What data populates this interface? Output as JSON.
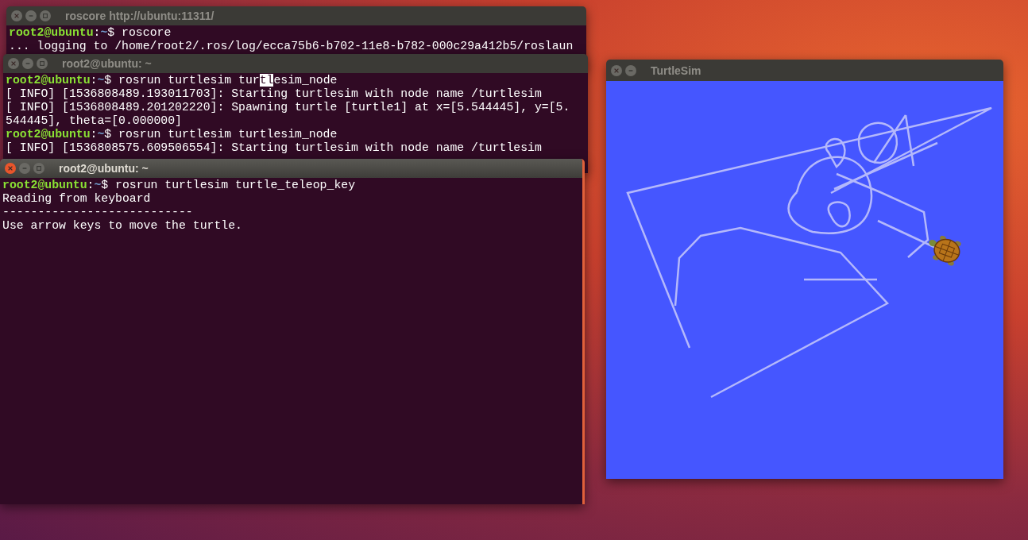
{
  "windows": [
    {
      "kind": "terminal",
      "title": "roscore http://ubuntu:11311/",
      "active": false,
      "lines": [
        {
          "kind": "prompt",
          "user": "root2@ubuntu",
          "separator": ":",
          "path": "~",
          "symbol": "$",
          "segments": [
            {
              "text": " roscore",
              "highlighted": false
            }
          ]
        },
        {
          "kind": "output",
          "text": "... logging to /home/root2/.ros/log/ecca75b6-b702-11e8-b782-000c29a412b5/roslaun"
        }
      ]
    },
    {
      "kind": "terminal",
      "title": "root2@ubuntu: ~",
      "active": false,
      "lines": [
        {
          "kind": "prompt",
          "user": "root2@ubuntu",
          "separator": ":",
          "path": "~",
          "symbol": "$",
          "segments": [
            {
              "text": " rosrun turtlesim tur",
              "highlighted": false
            },
            {
              "text": "tl",
              "highlighted": true
            },
            {
              "text": "esim_node",
              "highlighted": false
            }
          ]
        },
        {
          "kind": "output",
          "text": "[ INFO] [1536808489.193011703]: Starting turtlesim with node name /turtlesim"
        },
        {
          "kind": "output",
          "text": "[ INFO] [1536808489.201202220]: Spawning turtle [turtle1] at x=[5.544445], y=[5."
        },
        {
          "kind": "output",
          "text": "544445], theta=[0.000000]"
        },
        {
          "kind": "prompt",
          "user": "root2@ubuntu",
          "separator": ":",
          "path": "~",
          "symbol": "$",
          "segments": [
            {
              "text": " rosrun turtlesim turtlesim_node",
              "highlighted": false
            }
          ]
        },
        {
          "kind": "output",
          "text": "[ INFO] [1536808575.609506554]: Starting turtlesim with node name /turtlesim"
        }
      ]
    },
    {
      "kind": "terminal",
      "title": "root2@ubuntu: ~",
      "active": true,
      "lines": [
        {
          "kind": "prompt",
          "user": "root2@ubuntu",
          "separator": ":",
          "path": "~",
          "symbol": "$",
          "segments": [
            {
              "text": " rosrun turtlesim turtle_teleop_key",
              "highlighted": false
            }
          ]
        },
        {
          "kind": "output",
          "text": "Reading from keyboard"
        },
        {
          "kind": "output",
          "text": "---------------------------"
        },
        {
          "kind": "output",
          "text": "Use arrow keys to move the turtle."
        }
      ]
    },
    {
      "kind": "canvas",
      "title": "TurtleSim",
      "active": false
    }
  ]
}
